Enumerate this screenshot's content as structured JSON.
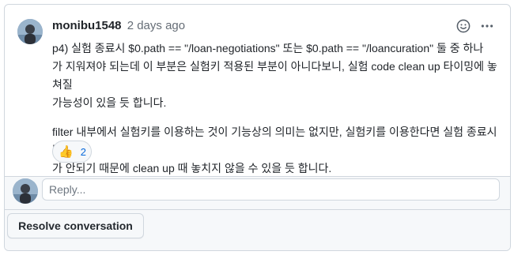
{
  "comment": {
    "author": "monibu1548",
    "timestamp": "2 days ago",
    "paragraphs": [
      "p4) 실험 종료시 $0.path == \"/loan-negotiations\" 또는 $0.path == \"/loancuration\" 둘 중 하나\n가 지워져야 되는데 이 부분은 실험키 적용된 부분이 아니다보니, 실험 code clean up 타이밍에 놓쳐질\n가능성이 있을 듯 합니다.",
      "filter 내부에서 실험키를 이용하는 것이 기능상의 의미는 없지만, 실험키를 이용한다면 실험 종료시 빌드\n가 안되기 때문에 clean up 때 놓치지 않을 수 있을 듯 합니다."
    ],
    "reaction": {
      "emoji": "👍",
      "count": "2"
    }
  },
  "reply": {
    "placeholder": "Reply..."
  },
  "footer": {
    "resolve_label": "Resolve conversation"
  },
  "icons": {
    "reaction_add": "smiley-icon",
    "more": "kebab-horizontal-icon"
  },
  "colors": {
    "border": "#d0d7de",
    "link": "#0969da",
    "muted": "#656d76",
    "subtle_bg": "#f6f8fa"
  }
}
